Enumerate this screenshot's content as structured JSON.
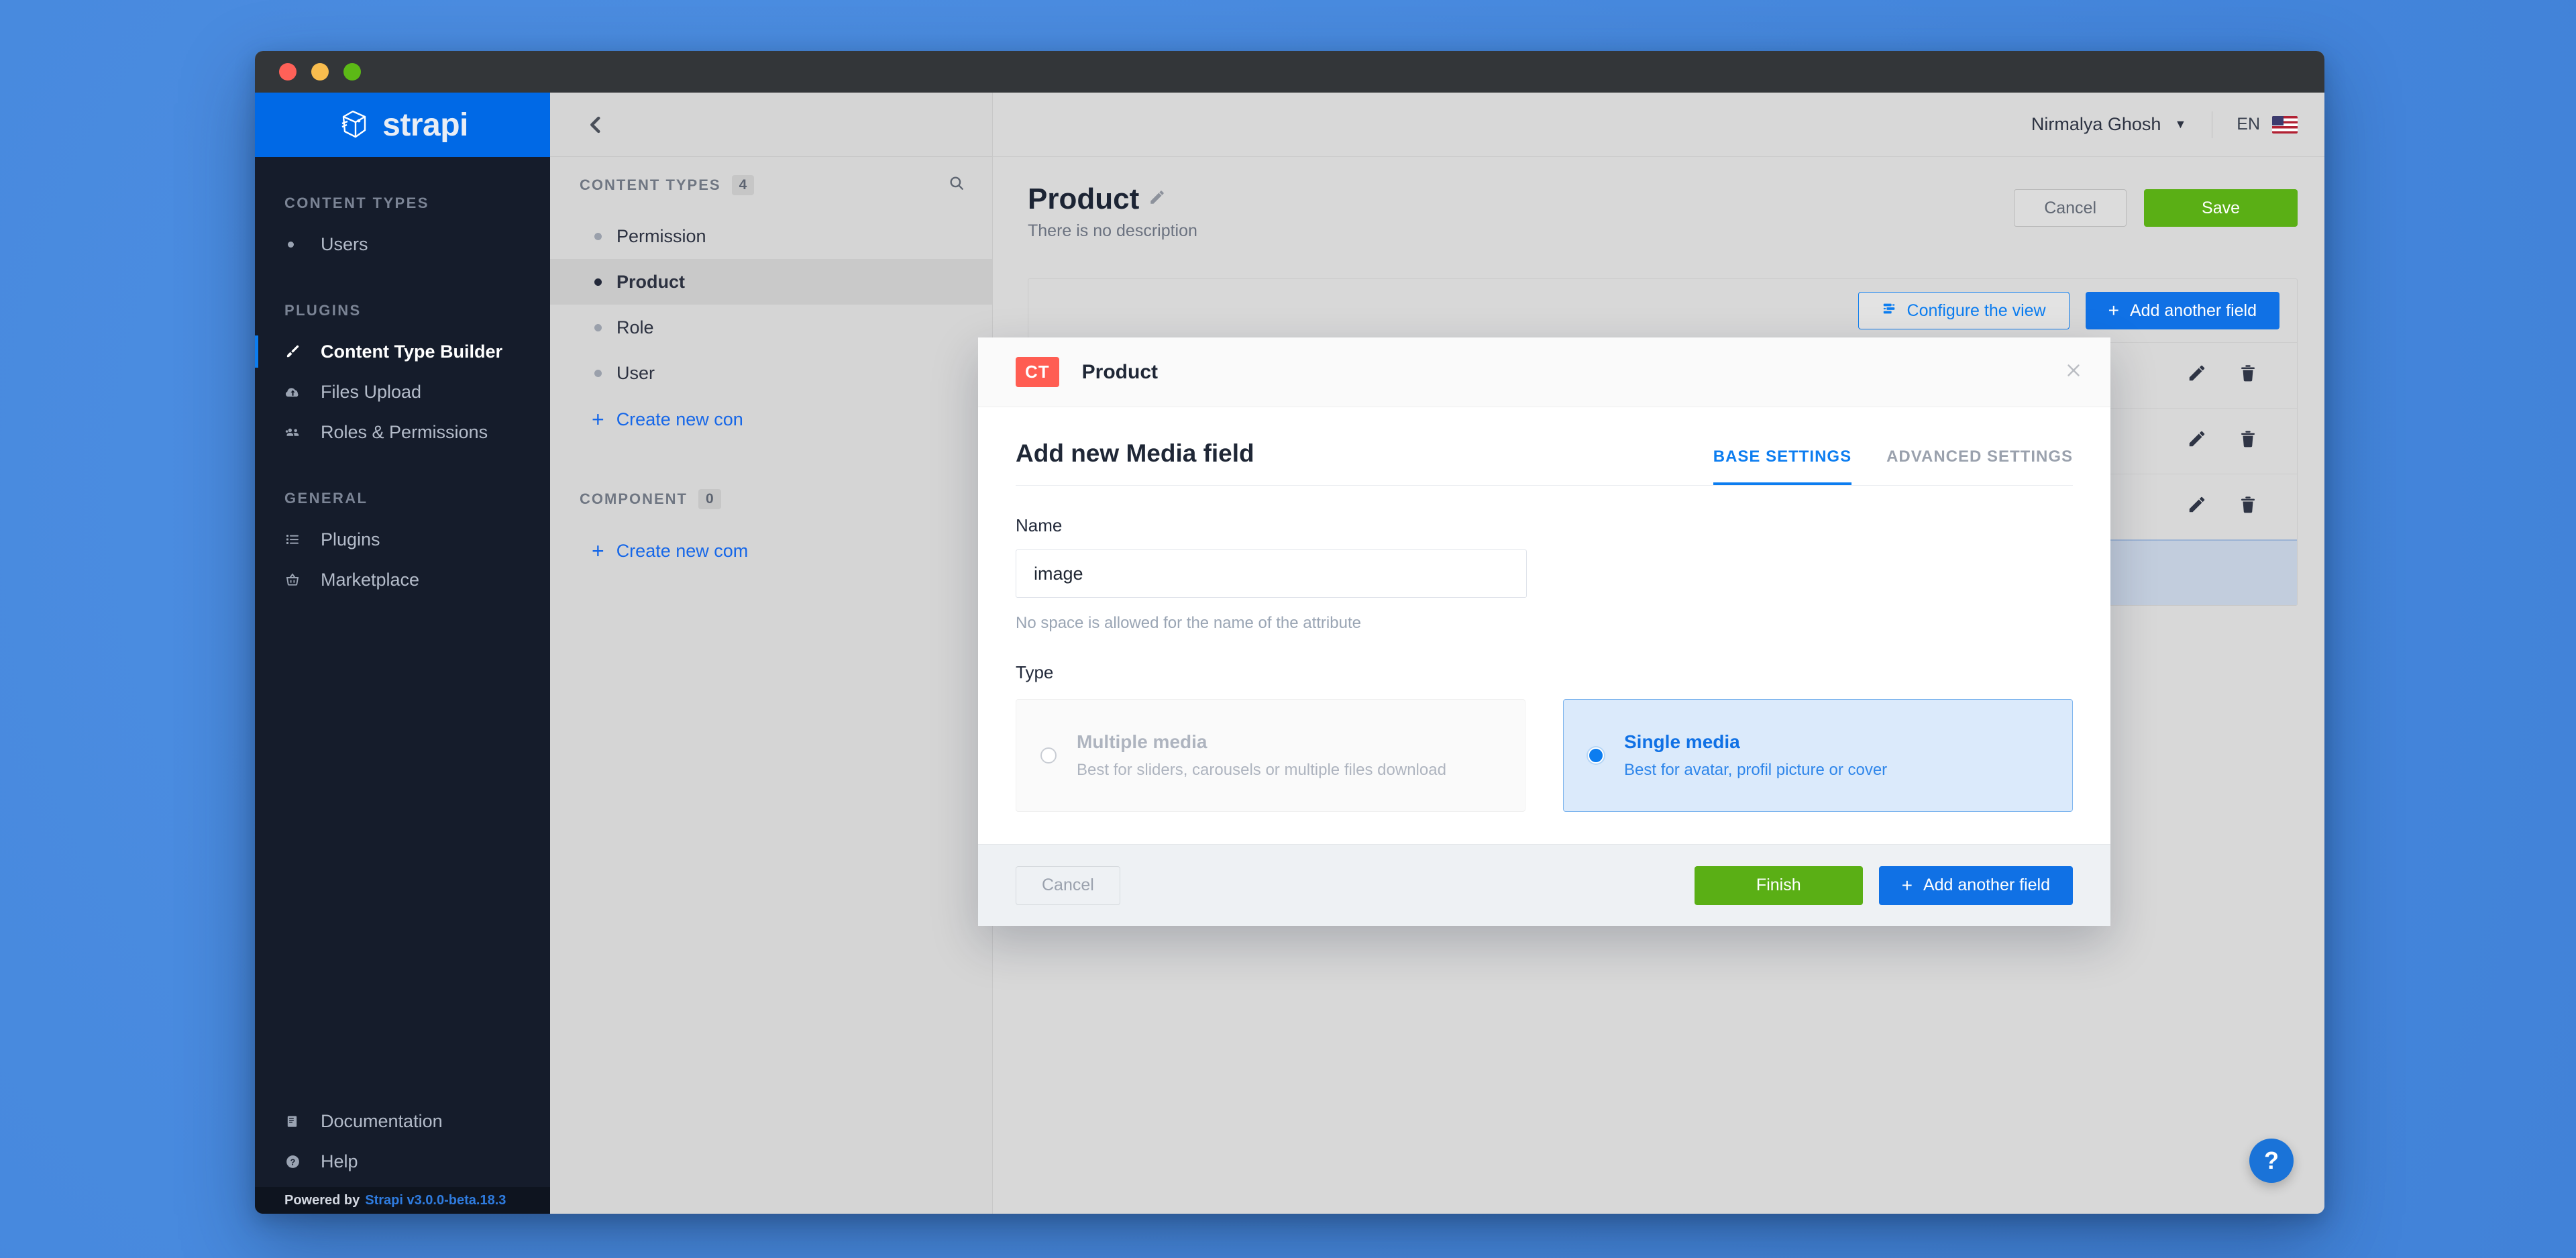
{
  "window": {
    "traffic_lights": [
      "close",
      "minimize",
      "maximize"
    ]
  },
  "brand": {
    "name": "strapi",
    "logo_icon": "strapi-logo-icon"
  },
  "sidebar": {
    "sections": [
      {
        "title": "CONTENT TYPES",
        "items": [
          {
            "label": "Users",
            "icon": "bullet-icon",
            "active": false
          }
        ]
      },
      {
        "title": "PLUGINS",
        "items": [
          {
            "label": "Content Type Builder",
            "icon": "paintbrush-icon",
            "active": true
          },
          {
            "label": "Files Upload",
            "icon": "cloud-upload-icon",
            "active": false
          },
          {
            "label": "Roles & Permissions",
            "icon": "users-group-icon",
            "active": false
          }
        ]
      },
      {
        "title": "GENERAL",
        "items": [
          {
            "label": "Plugins",
            "icon": "list-icon",
            "active": false
          },
          {
            "label": "Marketplace",
            "icon": "shopping-basket-icon",
            "active": false
          }
        ]
      }
    ],
    "footer_items": [
      {
        "label": "Documentation",
        "icon": "book-icon"
      },
      {
        "label": "Help",
        "icon": "question-circle-icon"
      }
    ],
    "powered_by": {
      "prefix": "Powered by",
      "link": "Strapi v3.0.0-beta.18.3"
    }
  },
  "ct_panel": {
    "collapse_icon": "chevron-left-icon",
    "content_types": {
      "label": "CONTENT TYPES",
      "count": "4",
      "search_icon": "search-icon",
      "items": [
        {
          "label": "Permission",
          "selected": false
        },
        {
          "label": "Product",
          "selected": true
        },
        {
          "label": "Role",
          "selected": false
        },
        {
          "label": "User",
          "selected": false
        }
      ],
      "create_link": "Create new con"
    },
    "component": {
      "label": "COMPONENT",
      "count": "0",
      "create_link": "Create new com"
    }
  },
  "header": {
    "user": "Nirmalya Ghosh",
    "user_caret_icon": "chevron-down-icon",
    "language_code": "EN",
    "flag_icon": "us-flag-icon"
  },
  "page": {
    "title": "Product",
    "edit_icon": "pencil-icon",
    "description": "There is no description",
    "cancel_label": "Cancel",
    "save_label": "Save"
  },
  "table": {
    "configure_view_label": "Configure the view",
    "configure_view_icon": "layout-list-icon",
    "add_field_label": "Add another field",
    "add_field_icon": "plus-icon",
    "rows": [
      {
        "edit_icon": "pencil-icon",
        "delete_icon": "trash-icon"
      },
      {
        "edit_icon": "pencil-icon",
        "delete_icon": "trash-icon"
      },
      {
        "edit_icon": "pencil-icon",
        "delete_icon": "trash-icon"
      }
    ]
  },
  "help_fab": {
    "label": "?",
    "icon": "question-mark-icon"
  },
  "modal": {
    "badge": "CT",
    "content_type_name": "Product",
    "close_icon": "close-icon",
    "title": "Add new Media field",
    "tabs": [
      {
        "label": "BASE SETTINGS",
        "active": true
      },
      {
        "label": "ADVANCED SETTINGS",
        "active": false
      }
    ],
    "name_label": "Name",
    "name_value": "image",
    "name_placeholder": "",
    "name_hint": "No space is allowed for the name of the attribute",
    "type_label": "Type",
    "type_options": [
      {
        "title": "Multiple media",
        "subtitle": "Best for sliders, carousels or multiple files download",
        "selected": false
      },
      {
        "title": "Single media",
        "subtitle": "Best for avatar, profil picture or cover",
        "selected": true
      }
    ],
    "cancel_label": "Cancel",
    "finish_label": "Finish",
    "add_field_label": "Add another field",
    "add_field_icon": "plus-icon"
  },
  "colors": {
    "desktop": "#4b8de0",
    "brand_blue": "#0069e6",
    "accent_blue": "#0c7df0",
    "sidebar_dark": "#151c2b",
    "green": "#5aaf15",
    "badge_red": "#ff5d52",
    "selected_card": "#dbeafb"
  }
}
